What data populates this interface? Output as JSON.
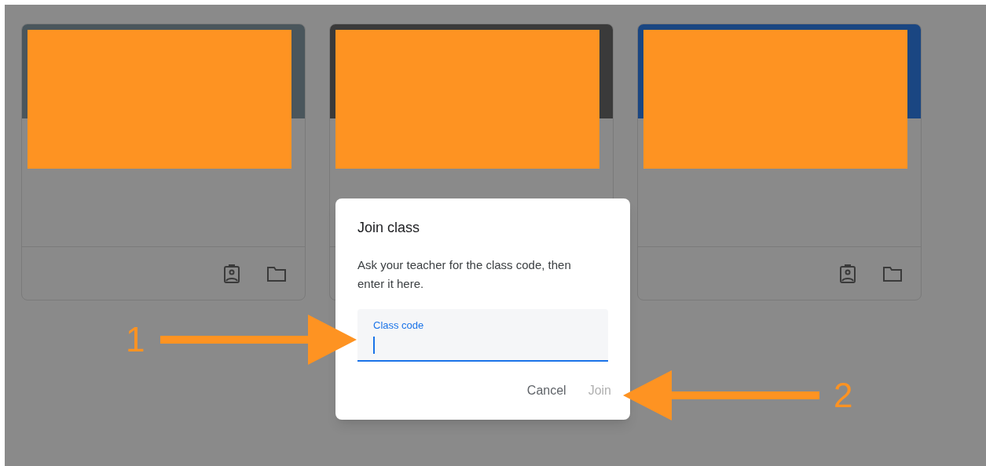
{
  "class_cards": [
    {
      "color": "#4a565c"
    },
    {
      "color": "#3a3a3a"
    },
    {
      "color": "#1a4682"
    }
  ],
  "dialog": {
    "title": "Join class",
    "message": "Ask your teacher for the class code, then enter it here.",
    "field": {
      "label": "Class code",
      "focused": true
    },
    "buttons": [
      {
        "label": "Cancel",
        "disabled": false
      },
      {
        "label": "Join",
        "disabled": true
      }
    ]
  },
  "annotations": [
    {
      "number": "1",
      "kind": "rightward"
    },
    {
      "number": "2",
      "kind": "leftward"
    }
  ]
}
